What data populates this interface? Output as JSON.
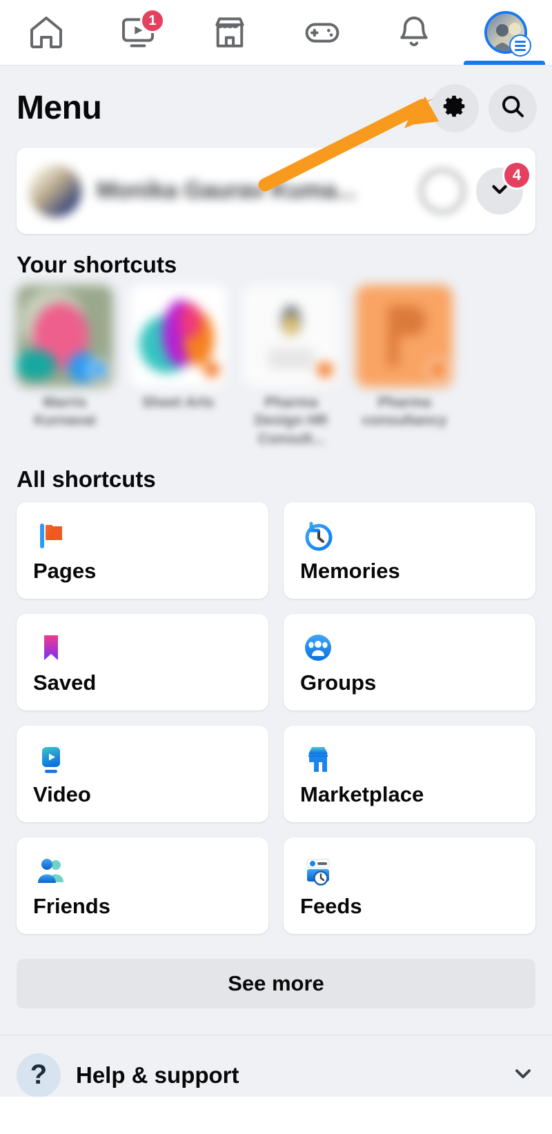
{
  "app": {
    "accent_blue": "#1878f2",
    "badge_red": "#e4405f",
    "annotation_orange": "#f79a1e",
    "background": "#eff1f5"
  },
  "tabbar": {
    "tabs": [
      {
        "name": "home",
        "icon": "home-icon",
        "badge": ""
      },
      {
        "name": "video",
        "icon": "video-icon",
        "badge": "1"
      },
      {
        "name": "marketplace",
        "icon": "store-icon",
        "badge": ""
      },
      {
        "name": "gaming",
        "icon": "gamepad-icon",
        "badge": ""
      },
      {
        "name": "notifications",
        "icon": "bell-icon",
        "badge": ""
      },
      {
        "name": "menu",
        "icon": "avatar-menu-icon",
        "badge": "",
        "active": true
      }
    ]
  },
  "header": {
    "title": "Menu",
    "settings_icon": "gear-icon",
    "search_icon": "search-icon"
  },
  "profile": {
    "name": "Monika Gaurav Kuma...",
    "name_blurred": true,
    "chevron_icon": "chevron-down-icon",
    "badge_count": "4"
  },
  "your_shortcuts": {
    "title": "Your shortcuts",
    "items": [
      {
        "label": "Marris Kurnavai",
        "blurred": true,
        "dot_color": "#2f9bf0"
      },
      {
        "label": "Sheet Arts",
        "blurred": true,
        "dot_color": "#f2711c"
      },
      {
        "label": "Pharma Design HR Consult...",
        "blurred": true,
        "dot_color": "#f2711c"
      },
      {
        "label": "Pharma consultancy",
        "blurred": true,
        "dot_color": "#f2711c"
      }
    ]
  },
  "all_shortcuts": {
    "title": "All shortcuts",
    "items": [
      {
        "label": "Pages",
        "icon": "flag-icon"
      },
      {
        "label": "Memories",
        "icon": "clock-rewind-icon"
      },
      {
        "label": "Saved",
        "icon": "bookmark-icon"
      },
      {
        "label": "Groups",
        "icon": "groups-icon"
      },
      {
        "label": "Video",
        "icon": "video-play-icon"
      },
      {
        "label": "Marketplace",
        "icon": "storefront-icon"
      },
      {
        "label": "Friends",
        "icon": "friends-icon"
      },
      {
        "label": "Feeds",
        "icon": "feeds-icon"
      }
    ],
    "see_more_label": "See more"
  },
  "help": {
    "label": "Help & support",
    "icon": "question-mark-icon",
    "chevron_icon": "chevron-down-icon"
  },
  "annotation": {
    "type": "arrow",
    "color": "#f79a1e",
    "points_to": "gear-icon"
  }
}
